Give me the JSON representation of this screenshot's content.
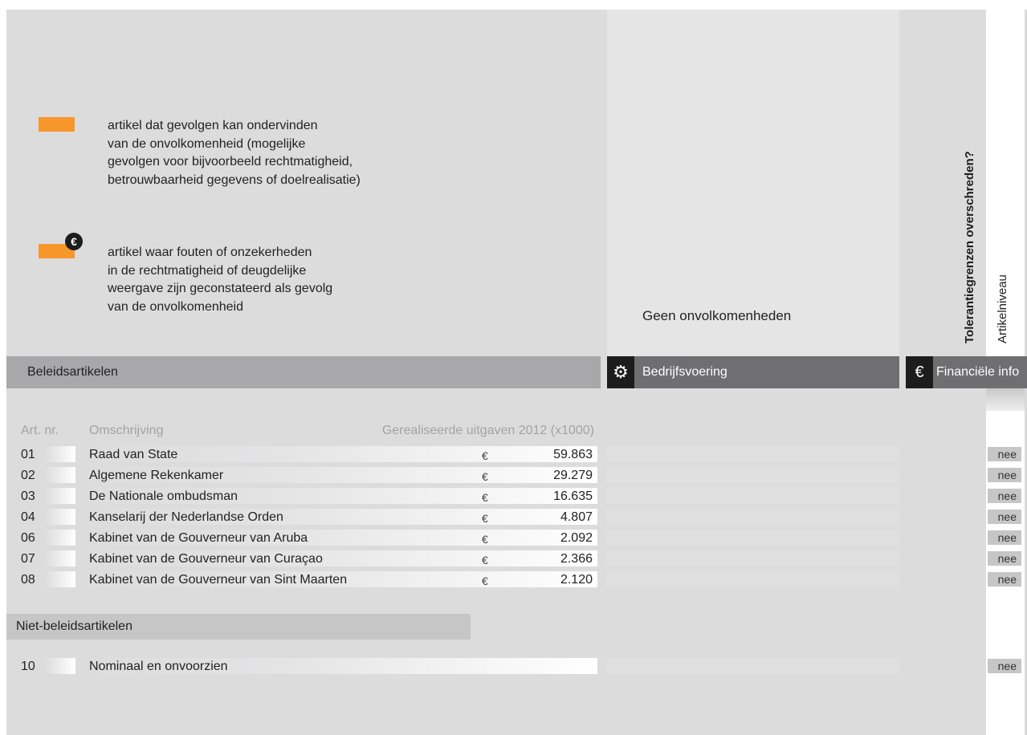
{
  "colors": {
    "accent": "#f7962b",
    "panel": "#dcdcdd",
    "band_gray": "#a8a8aa",
    "band_dark": "#6f6f72"
  },
  "legend": {
    "item1": {
      "icon": "orange-swatch",
      "lines": [
        "artikel dat gevolgen kan ondervinden",
        "van de onvolkomenheid (mogelijke",
        "gevolgen voor bijvoorbeeld rechtmatigheid,",
        "betrouwbaarheid gegevens of doelrealisatie)"
      ]
    },
    "item2": {
      "icon": "orange-swatch-euro",
      "euro_symbol": "€",
      "lines": [
        "artikel waar fouten of onzekerheden",
        "in de rechtmatigheid of deugdelijke",
        "weergave zijn geconstateerd als gevolg",
        "van de onvolkomenheid"
      ]
    }
  },
  "geen_text": "Geen onvolkomenheden",
  "vertical": {
    "tolerance": "Tolerantiegrenzen overschreden?",
    "article_level": "Artikelniveau"
  },
  "bands": {
    "beleid": "Beleidsartikelen",
    "bedrijf": "Bedrijfsvoering",
    "bedrijf_icon": "gear-icon",
    "financieel": "Financiële info",
    "financieel_icon": "euro-icon",
    "financieel_symbol": "€",
    "gear_symbol": "⚙"
  },
  "headers": {
    "art_nr": "Art. nr.",
    "omschrijving": "Omschrijving",
    "uitgaven": "Gerealiseerde uitgaven 2012 (x1000)"
  },
  "rows": [
    {
      "nr": "01",
      "name": "Raad van State",
      "currency": "€",
      "value": "59.863",
      "tolerance": "nee"
    },
    {
      "nr": "02",
      "name": "Algemene Rekenkamer",
      "currency": "€",
      "value": "29.279",
      "tolerance": "nee"
    },
    {
      "nr": "03",
      "name": "De Nationale ombudsman",
      "currency": "€",
      "value": "16.635",
      "tolerance": "nee"
    },
    {
      "nr": "04",
      "name": "Kanselarij der Nederlandse Orden",
      "currency": "€",
      "value": "4.807",
      "tolerance": "nee"
    },
    {
      "nr": "06",
      "name": "Kabinet van de Gouverneur van Aruba",
      "currency": "€",
      "value": "2.092",
      "tolerance": "nee"
    },
    {
      "nr": "07",
      "name": "Kabinet van de Gouverneur van Curaçao",
      "currency": "€",
      "value": "2.366",
      "tolerance": "nee"
    },
    {
      "nr": "08",
      "name": "Kabinet van de Gouverneur van Sint Maarten",
      "currency": "€",
      "value": "2.120",
      "tolerance": "nee"
    }
  ],
  "niet_beleid": {
    "label": "Niet-beleidsartikelen",
    "rows": [
      {
        "nr": "10",
        "name": "Nominaal en onvoorzien",
        "tolerance": "nee"
      }
    ]
  }
}
